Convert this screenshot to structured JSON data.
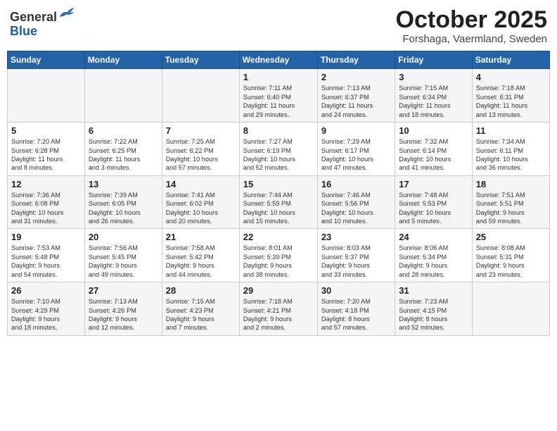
{
  "header": {
    "logo_line1": "General",
    "logo_line2": "Blue",
    "month_title": "October 2025",
    "location": "Forshaga, Vaermland, Sweden"
  },
  "days_of_week": [
    "Sunday",
    "Monday",
    "Tuesday",
    "Wednesday",
    "Thursday",
    "Friday",
    "Saturday"
  ],
  "weeks": [
    [
      {
        "day": "",
        "info": ""
      },
      {
        "day": "",
        "info": ""
      },
      {
        "day": "",
        "info": ""
      },
      {
        "day": "1",
        "info": "Sunrise: 7:11 AM\nSunset: 6:40 PM\nDaylight: 11 hours\nand 29 minutes."
      },
      {
        "day": "2",
        "info": "Sunrise: 7:13 AM\nSunset: 6:37 PM\nDaylight: 11 hours\nand 24 minutes."
      },
      {
        "day": "3",
        "info": "Sunrise: 7:15 AM\nSunset: 6:34 PM\nDaylight: 11 hours\nand 18 minutes."
      },
      {
        "day": "4",
        "info": "Sunrise: 7:18 AM\nSunset: 6:31 PM\nDaylight: 11 hours\nand 13 minutes."
      }
    ],
    [
      {
        "day": "5",
        "info": "Sunrise: 7:20 AM\nSunset: 6:28 PM\nDaylight: 11 hours\nand 8 minutes."
      },
      {
        "day": "6",
        "info": "Sunrise: 7:22 AM\nSunset: 6:25 PM\nDaylight: 11 hours\nand 3 minutes."
      },
      {
        "day": "7",
        "info": "Sunrise: 7:25 AM\nSunset: 6:22 PM\nDaylight: 10 hours\nand 57 minutes."
      },
      {
        "day": "8",
        "info": "Sunrise: 7:27 AM\nSunset: 6:19 PM\nDaylight: 10 hours\nand 52 minutes."
      },
      {
        "day": "9",
        "info": "Sunrise: 7:29 AM\nSunset: 6:17 PM\nDaylight: 10 hours\nand 47 minutes."
      },
      {
        "day": "10",
        "info": "Sunrise: 7:32 AM\nSunset: 6:14 PM\nDaylight: 10 hours\nand 41 minutes."
      },
      {
        "day": "11",
        "info": "Sunrise: 7:34 AM\nSunset: 6:11 PM\nDaylight: 10 hours\nand 36 minutes."
      }
    ],
    [
      {
        "day": "12",
        "info": "Sunrise: 7:36 AM\nSunset: 6:08 PM\nDaylight: 10 hours\nand 31 minutes."
      },
      {
        "day": "13",
        "info": "Sunrise: 7:39 AM\nSunset: 6:05 PM\nDaylight: 10 hours\nand 26 minutes."
      },
      {
        "day": "14",
        "info": "Sunrise: 7:41 AM\nSunset: 6:02 PM\nDaylight: 10 hours\nand 20 minutes."
      },
      {
        "day": "15",
        "info": "Sunrise: 7:44 AM\nSunset: 5:59 PM\nDaylight: 10 hours\nand 15 minutes."
      },
      {
        "day": "16",
        "info": "Sunrise: 7:46 AM\nSunset: 5:56 PM\nDaylight: 10 hours\nand 10 minutes."
      },
      {
        "day": "17",
        "info": "Sunrise: 7:48 AM\nSunset: 5:53 PM\nDaylight: 10 hours\nand 5 minutes."
      },
      {
        "day": "18",
        "info": "Sunrise: 7:51 AM\nSunset: 5:51 PM\nDaylight: 9 hours\nand 59 minutes."
      }
    ],
    [
      {
        "day": "19",
        "info": "Sunrise: 7:53 AM\nSunset: 5:48 PM\nDaylight: 9 hours\nand 54 minutes."
      },
      {
        "day": "20",
        "info": "Sunrise: 7:56 AM\nSunset: 5:45 PM\nDaylight: 9 hours\nand 49 minutes."
      },
      {
        "day": "21",
        "info": "Sunrise: 7:58 AM\nSunset: 5:42 PM\nDaylight: 9 hours\nand 44 minutes."
      },
      {
        "day": "22",
        "info": "Sunrise: 8:01 AM\nSunset: 5:39 PM\nDaylight: 9 hours\nand 38 minutes."
      },
      {
        "day": "23",
        "info": "Sunrise: 8:03 AM\nSunset: 5:37 PM\nDaylight: 9 hours\nand 33 minutes."
      },
      {
        "day": "24",
        "info": "Sunrise: 8:06 AM\nSunset: 5:34 PM\nDaylight: 9 hours\nand 28 minutes."
      },
      {
        "day": "25",
        "info": "Sunrise: 8:08 AM\nSunset: 5:31 PM\nDaylight: 9 hours\nand 23 minutes."
      }
    ],
    [
      {
        "day": "26",
        "info": "Sunrise: 7:10 AM\nSunset: 4:29 PM\nDaylight: 9 hours\nand 18 minutes."
      },
      {
        "day": "27",
        "info": "Sunrise: 7:13 AM\nSunset: 4:26 PM\nDaylight: 9 hours\nand 12 minutes."
      },
      {
        "day": "28",
        "info": "Sunrise: 7:15 AM\nSunset: 4:23 PM\nDaylight: 9 hours\nand 7 minutes."
      },
      {
        "day": "29",
        "info": "Sunrise: 7:18 AM\nSunset: 4:21 PM\nDaylight: 9 hours\nand 2 minutes."
      },
      {
        "day": "30",
        "info": "Sunrise: 7:20 AM\nSunset: 4:18 PM\nDaylight: 8 hours\nand 57 minutes."
      },
      {
        "day": "31",
        "info": "Sunrise: 7:23 AM\nSunset: 4:15 PM\nDaylight: 8 hours\nand 52 minutes."
      },
      {
        "day": "",
        "info": ""
      }
    ]
  ]
}
